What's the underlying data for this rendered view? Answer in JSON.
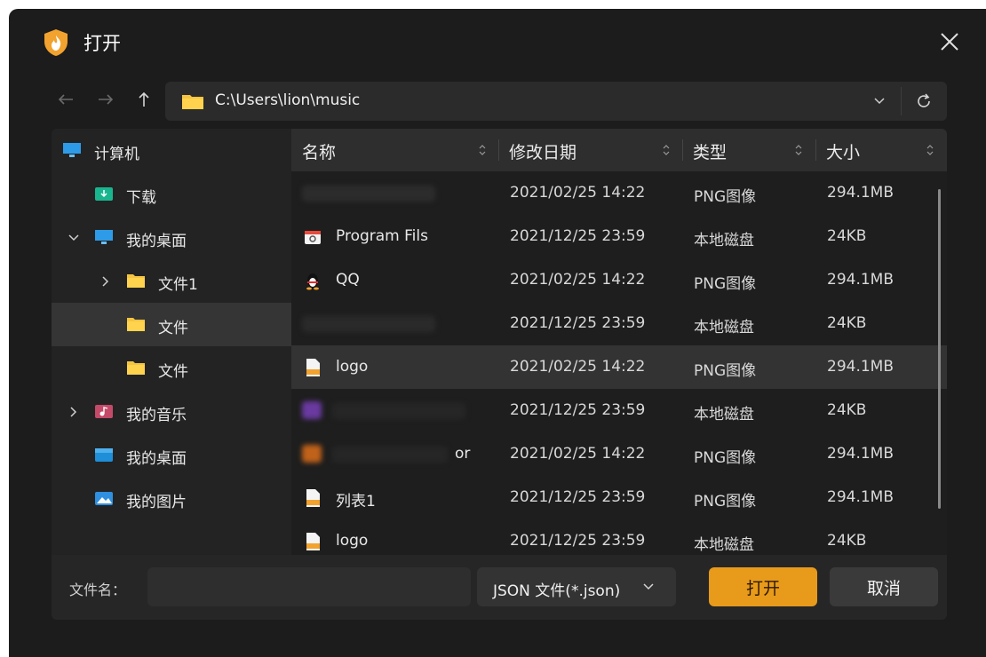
{
  "window": {
    "title": "打开",
    "app_icon": "shield-flame-icon",
    "close_icon": "close-icon"
  },
  "navigation": {
    "back_icon": "arrow-left-icon",
    "forward_icon": "arrow-right-icon",
    "up_icon": "arrow-up-icon",
    "path": "C:\\Users\\lion\\music",
    "dropdown_icon": "chevron-down-icon",
    "refresh_icon": "refresh-icon"
  },
  "sidebar": {
    "items": [
      {
        "label": "计算机",
        "icon": "computer-icon",
        "expander": "none"
      },
      {
        "label": "下载",
        "icon": "download-folder-icon",
        "expander": "none"
      },
      {
        "label": "我的桌面",
        "icon": "desktop-icon",
        "expander": "expanded"
      },
      {
        "label": "文件1",
        "icon": "folder-icon",
        "expander": "collapsed"
      },
      {
        "label": "文件",
        "icon": "folder-icon",
        "expander": "none",
        "selected": true
      },
      {
        "label": "文件",
        "icon": "folder-icon",
        "expander": "none"
      },
      {
        "label": "我的音乐",
        "icon": "music-folder-icon",
        "expander": "collapsed"
      },
      {
        "label": "我的桌面",
        "icon": "desktop-folder-icon",
        "expander": "none"
      },
      {
        "label": "我的图片",
        "icon": "pictures-folder-icon",
        "expander": "none"
      }
    ]
  },
  "table": {
    "columns": [
      {
        "label": "名称"
      },
      {
        "label": "修改日期"
      },
      {
        "label": "类型"
      },
      {
        "label": "大小"
      }
    ],
    "rows": [
      {
        "name": "",
        "date": "2021/02/25 14:22",
        "type": "PNG图像",
        "size": "294.1MB",
        "icon": "blurred",
        "blurred": true
      },
      {
        "name": "Program Fils",
        "date": "2021/12/25 23:59",
        "type": "本地磁盘",
        "size": "24KB",
        "icon": "program-files-icon"
      },
      {
        "name": "QQ",
        "date": "2021/02/25 14:22",
        "type": "PNG图像",
        "size": "294.1MB",
        "icon": "qq-penguin-icon"
      },
      {
        "name": "",
        "date": "2021/12/25 23:59",
        "type": "本地磁盘",
        "size": "24KB",
        "icon": "blurred",
        "blurred": true
      },
      {
        "name": "logo",
        "date": "2021/02/25 14:22",
        "type": "PNG图像",
        "size": "294.1MB",
        "icon": "image-file-icon",
        "highlight": true
      },
      {
        "name": "",
        "date": "2021/12/25 23:59",
        "type": "本地磁盘",
        "size": "24KB",
        "icon": "purple-app-icon",
        "blurred": true
      },
      {
        "name": "or",
        "date": "2021/02/25 14:22",
        "type": "PNG图像",
        "size": "294.1MB",
        "icon": "orange-app-icon",
        "blurred": true
      },
      {
        "name": "列表1",
        "date": "2021/12/25 23:59",
        "type": "PNG图像",
        "size": "294.1MB",
        "icon": "image-file-icon"
      },
      {
        "name": "logo",
        "date": "2021/12/25 23:59",
        "type": "本地磁盘",
        "size": "24KB",
        "icon": "image-file-icon"
      }
    ]
  },
  "footer": {
    "filename_label": "文件名：",
    "filename_value": "",
    "filetype": "JSON 文件(*.json)",
    "open_label": "打开",
    "cancel_label": "取消"
  },
  "colors": {
    "accent": "#e89a1b",
    "background": "#1c1c1c"
  }
}
